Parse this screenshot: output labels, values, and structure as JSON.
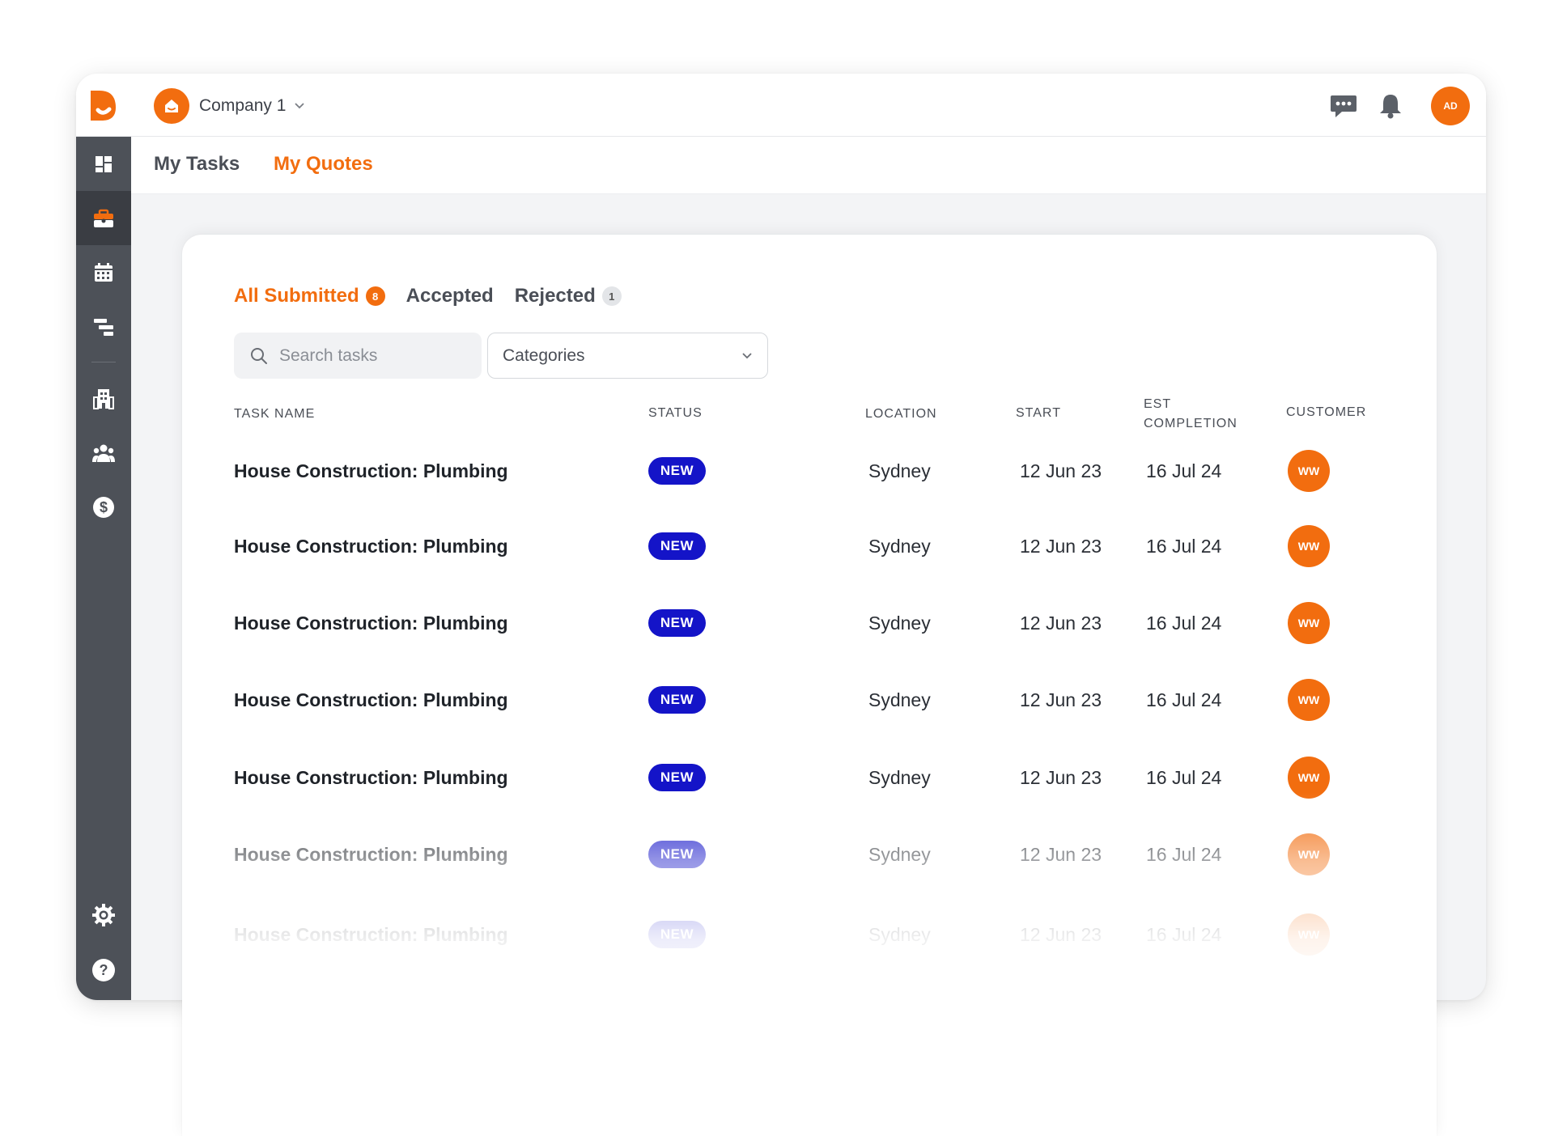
{
  "header": {
    "company_name": "Company 1",
    "user_initials": "AD"
  },
  "subnav": {
    "tabs": [
      {
        "label": "My Tasks",
        "active": false
      },
      {
        "label": "My Quotes",
        "active": true
      }
    ]
  },
  "filters": {
    "tabs": [
      {
        "label": "All Submitted",
        "count": "8",
        "active": true
      },
      {
        "label": "Accepted",
        "count": "",
        "active": false
      },
      {
        "label": "Rejected",
        "count": "1",
        "active": false
      }
    ],
    "search_placeholder": "Search tasks",
    "categories_label": "Categories"
  },
  "table": {
    "columns": {
      "task_name": "TASK NAME",
      "status": "STATUS",
      "location": "LOCATION",
      "start": "START",
      "est_completion_line1": "EST",
      "est_completion_line2": "COMPLETION",
      "customer": "CUSTOMER"
    },
    "rows": [
      {
        "task": "House Construction: Plumbing",
        "status": "NEW",
        "location": "Sydney",
        "start": "12 Jun 23",
        "completion": "16 Jul 24",
        "customer": "WW"
      },
      {
        "task": "House Construction: Plumbing",
        "status": "NEW",
        "location": "Sydney",
        "start": "12 Jun 23",
        "completion": "16 Jul 24",
        "customer": "WW"
      },
      {
        "task": "House Construction: Plumbing",
        "status": "NEW",
        "location": "Sydney",
        "start": "12 Jun 23",
        "completion": "16 Jul 24",
        "customer": "WW"
      },
      {
        "task": "House Construction: Plumbing",
        "status": "NEW",
        "location": "Sydney",
        "start": "12 Jun 23",
        "completion": "16 Jul 24",
        "customer": "WW"
      },
      {
        "task": "House Construction: Plumbing",
        "status": "NEW",
        "location": "Sydney",
        "start": "12 Jun 23",
        "completion": "16 Jul 24",
        "customer": "WW"
      },
      {
        "task": "House Construction: Plumbing",
        "status": "NEW",
        "location": "Sydney",
        "start": "12 Jun 23",
        "completion": "16 Jul 24",
        "customer": "WW"
      },
      {
        "task": "House Construction: Plumbing",
        "status": "NEW",
        "location": "Sydney",
        "start": "12 Jun 23",
        "completion": "16 Jul 24",
        "customer": "WW"
      }
    ]
  },
  "sidebar": {
    "items": [
      {
        "icon": "dashboard-icon"
      },
      {
        "icon": "briefcase-icon",
        "active": true
      },
      {
        "icon": "calendar-icon"
      },
      {
        "icon": "timeline-icon"
      },
      {
        "icon": "building-icon"
      },
      {
        "icon": "team-icon"
      },
      {
        "icon": "dollar-icon"
      },
      {
        "icon": "settings-icon"
      },
      {
        "icon": "help-icon"
      }
    ]
  },
  "colors": {
    "accent": "#f26d0f",
    "status_new": "#1414c8",
    "sidebar": "#4d5158"
  }
}
